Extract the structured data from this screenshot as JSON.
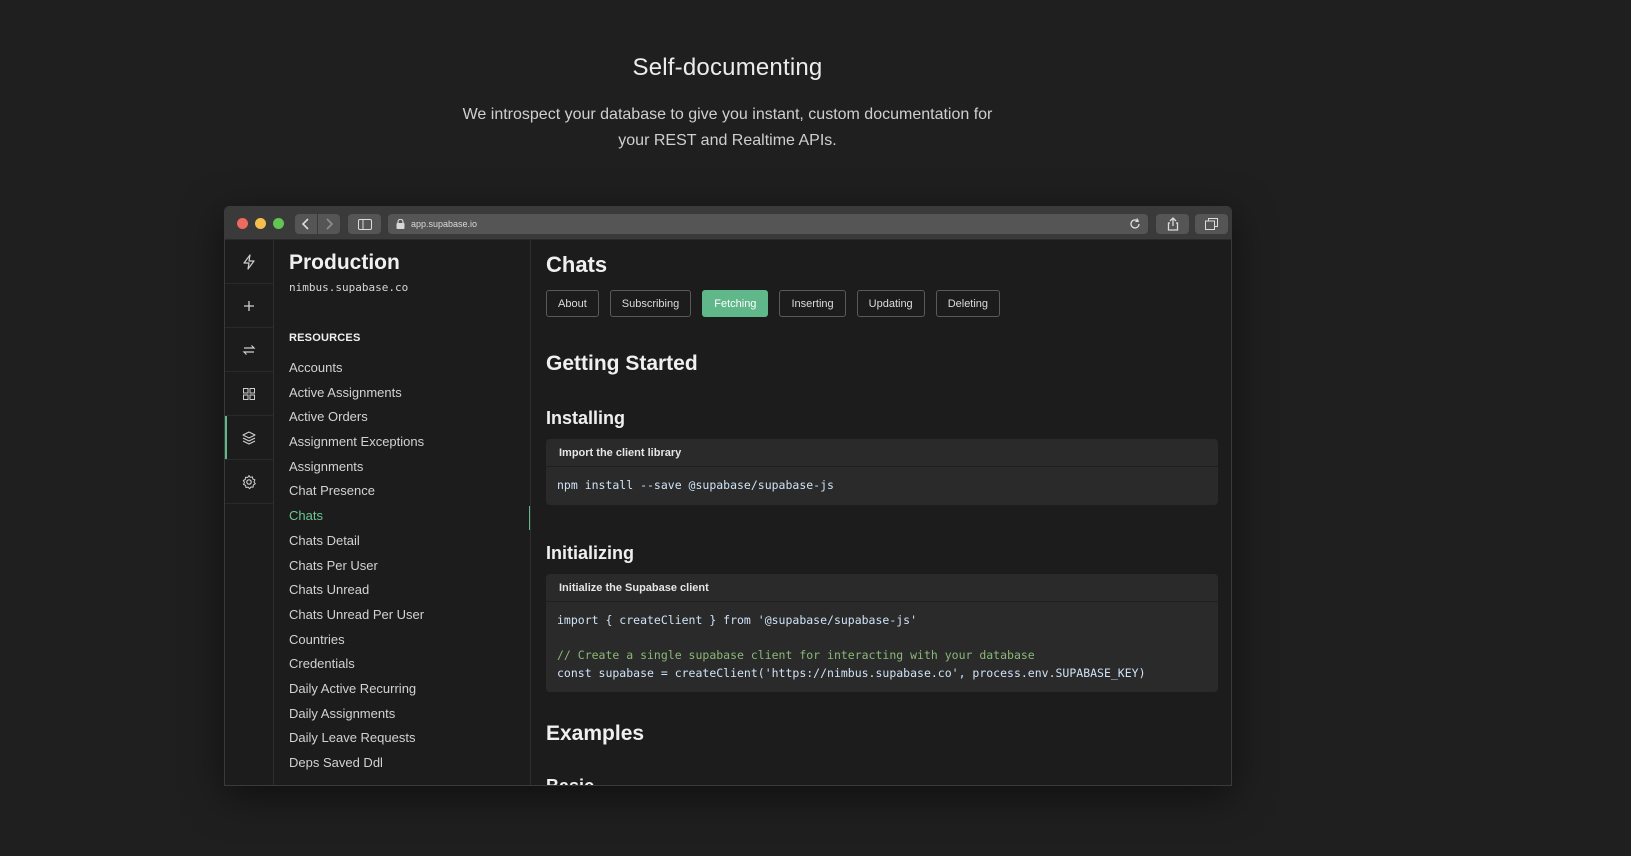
{
  "hero": {
    "title": "Self-documenting",
    "subtitle": "We introspect your database to give you instant, custom documentation for your REST and Realtime APIs."
  },
  "browser": {
    "url": "app.supabase.io",
    "icons": [
      "back-icon",
      "forward-icon",
      "sidebar-icon",
      "lock-icon",
      "reload-icon",
      "share-icon",
      "tabs-icon"
    ]
  },
  "rail": {
    "items": [
      {
        "icon": "lightning-icon"
      },
      {
        "icon": "plus-icon"
      },
      {
        "icon": "sync-icon"
      },
      {
        "icon": "grid-icon"
      },
      {
        "icon": "layers-icon",
        "active": true
      },
      {
        "icon": "gear-icon"
      }
    ]
  },
  "nav": {
    "project": "Production",
    "host": "nimbus.supabase.co",
    "section": "RESOURCES",
    "items": [
      "Accounts",
      "Active Assignments",
      "Active Orders",
      "Assignment Exceptions",
      "Assignments",
      "Chat Presence",
      "Chats",
      "Chats Detail",
      "Chats Per User",
      "Chats Unread",
      "Chats Unread Per User",
      "Countries",
      "Credentials",
      "Daily Active Recurring",
      "Daily Assignments",
      "Daily Leave Requests",
      "Deps Saved Ddl"
    ],
    "active": "Chats"
  },
  "content": {
    "title": "Chats",
    "tabs": [
      "About",
      "Subscribing",
      "Fetching",
      "Inserting",
      "Updating",
      "Deleting"
    ],
    "active_tab": "Fetching",
    "getting_started": "Getting Started",
    "installing": {
      "heading": "Installing",
      "block_title": "Import the client library",
      "code": "npm install --save @supabase/supabase-js"
    },
    "initializing": {
      "heading": "Initializing",
      "block_title": "Initialize the Supabase client",
      "code_import": "import { createClient } from '@supabase/supabase-js'",
      "code_comment": "// Create a single supabase client for interacting with your database",
      "code_const": "const supabase = createClient('https://nimbus.supabase.co', process.env.SUPABASE_KEY)"
    },
    "examples": "Examples",
    "basic": "Basic"
  },
  "colors": {
    "accent": "#5fb78a",
    "background": "#1f1f1f",
    "panel": "#1c1c1c",
    "code_bg": "#2a2a2a"
  }
}
